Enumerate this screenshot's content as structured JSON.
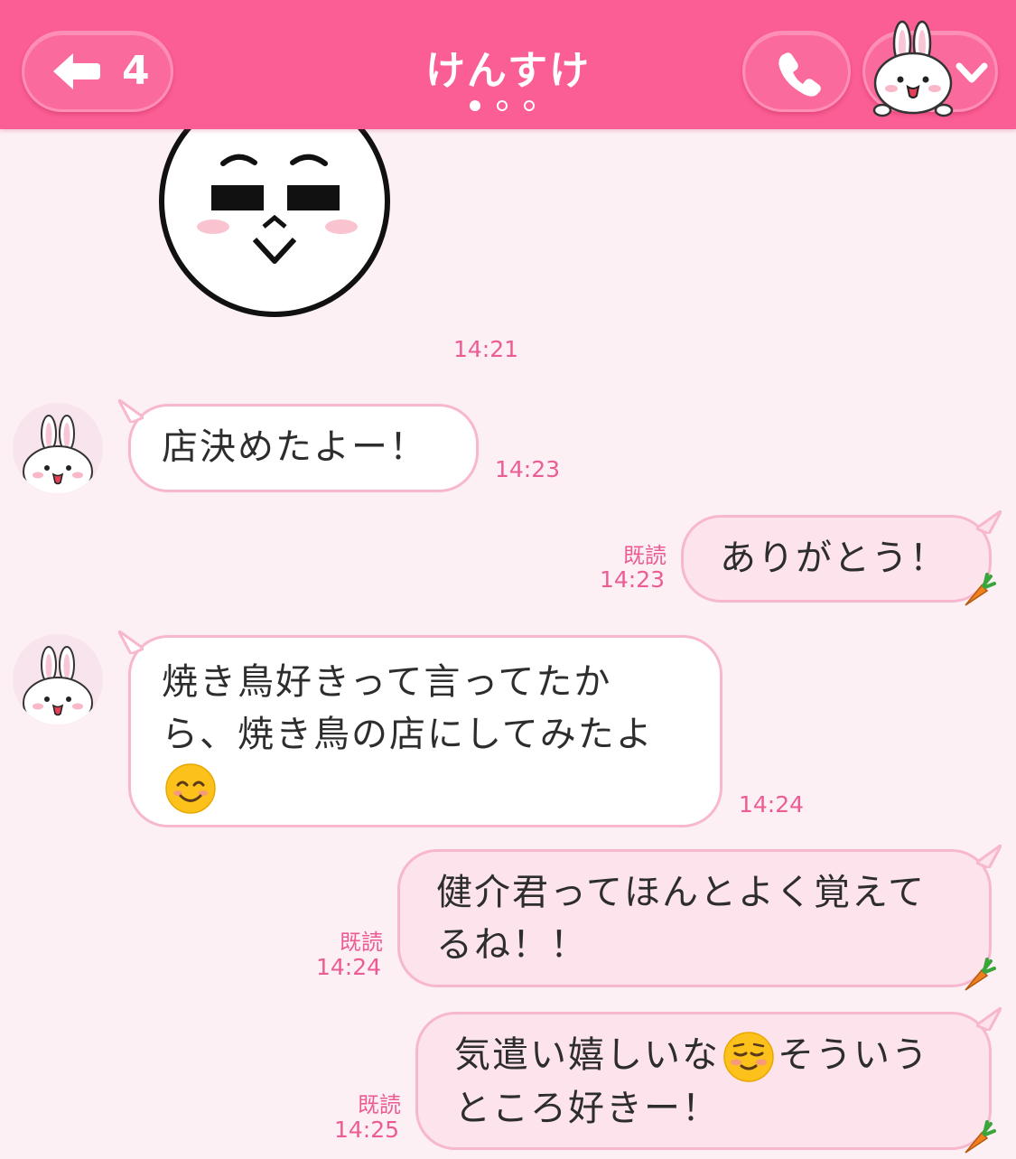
{
  "header": {
    "back_count": "4",
    "title": "けんすけ",
    "page_dots": 3,
    "active_dot": 0,
    "accent_color": "#fb5e94",
    "icons": [
      "back-arrow-icon",
      "phone-icon",
      "chevron-down-icon",
      "bunny-avatar-icon"
    ]
  },
  "sticker": {
    "time": "14:21",
    "name": "moon-sticker"
  },
  "messages": [
    {
      "side": "in",
      "text": "店決めたよー！",
      "time": "14:23"
    },
    {
      "side": "out",
      "read": "既読",
      "text": "ありがとう！",
      "time": "14:23"
    },
    {
      "side": "in",
      "line1": "焼き鳥好きって言ってたか",
      "line2": "ら、焼き鳥の店にしてみたよ",
      "emoji": "smiling-face-emoji",
      "time": "14:24"
    },
    {
      "side": "out",
      "read": "既読",
      "line1": "健介君ってほんとよく覚えて",
      "line2": "るね！！",
      "time": "14:24"
    },
    {
      "side": "out",
      "read": "既読",
      "line1a": "気遣い嬉しいな",
      "emoji": "relieved-smile-emoji",
      "line1b": "そういう",
      "line2": "ところ好きー！",
      "time": "14:25"
    }
  ],
  "colors": {
    "bubble_out": "#fce3ec",
    "bubble_border": "#f6b7cf",
    "time_text": "#ec5c94",
    "background": "#fdf0f4"
  }
}
